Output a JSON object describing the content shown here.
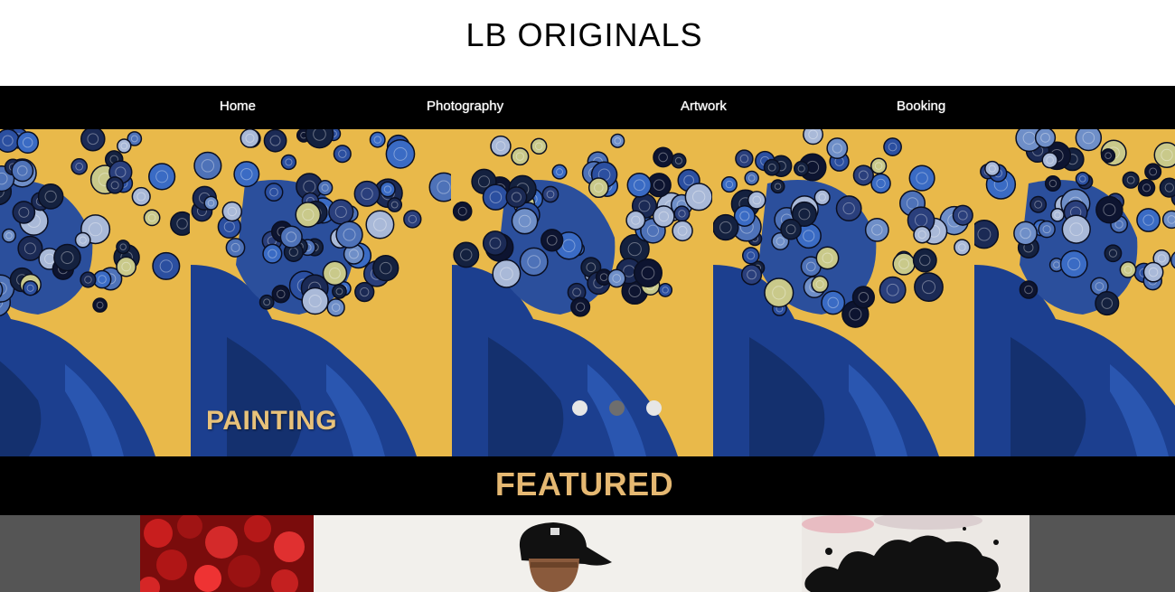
{
  "header": {
    "title": "LB ORIGINALS"
  },
  "nav": {
    "items": [
      {
        "label": "Home"
      },
      {
        "label": "Photography"
      },
      {
        "label": "Artwork"
      },
      {
        "label": "Booking"
      }
    ]
  },
  "hero": {
    "caption": "PAINTING",
    "slide_count": 3,
    "active_slide": 1,
    "colors": {
      "background": "#e9b94a",
      "figure": "#1c3f8f",
      "caption": "#e8c27a"
    }
  },
  "featured": {
    "title": "FEATURED"
  },
  "gallery": {
    "items": [
      {
        "name": "red-painting-thumbnail"
      },
      {
        "name": "portrait-photo-thumbnail"
      },
      {
        "name": "ink-splatter-thumbnail"
      }
    ]
  },
  "colors": {
    "nav_background": "#000000",
    "featured_text": "#e5b872",
    "gallery_background": "#555555"
  }
}
